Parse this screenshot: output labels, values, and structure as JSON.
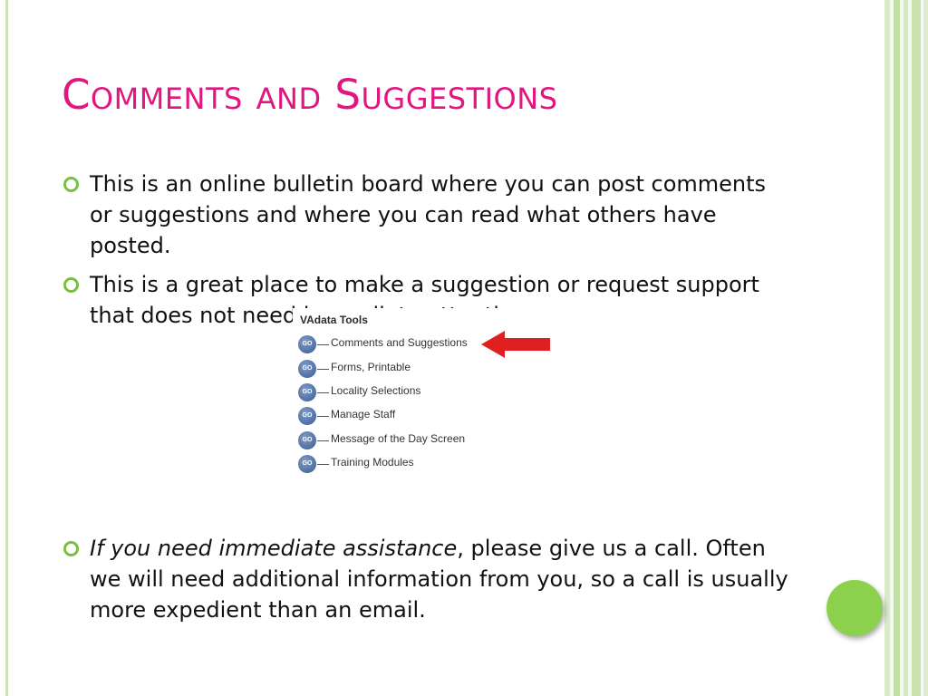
{
  "slide": {
    "title": "Comments and Suggestions",
    "bullets": [
      {
        "text": "This is an online bulletin board where you can post comments or suggestions and where you can read what others have posted."
      },
      {
        "text": "This is a great place to make a suggestion or request support that does not need immediate attention."
      },
      {
        "italic": "If you need immediate assistance",
        "text": ", please give us a call. Often we will need additional information from you, so a call is usually more expedient than an email."
      }
    ]
  },
  "screenshot": {
    "title": "VAdata Tools",
    "button_label": "GO",
    "items": [
      "Comments and Suggestions",
      "Forms, Printable",
      "Locality Selections",
      "Manage Staff",
      "Message of the Day Screen",
      "Training Modules"
    ],
    "highlighted_item": "Comments and Suggestions"
  },
  "colors": {
    "title": "#e2167f",
    "bullet": "#78c042",
    "arrow": "#e02020",
    "accent_circle": "#8bd14e",
    "go_button": "#3a5b92"
  }
}
